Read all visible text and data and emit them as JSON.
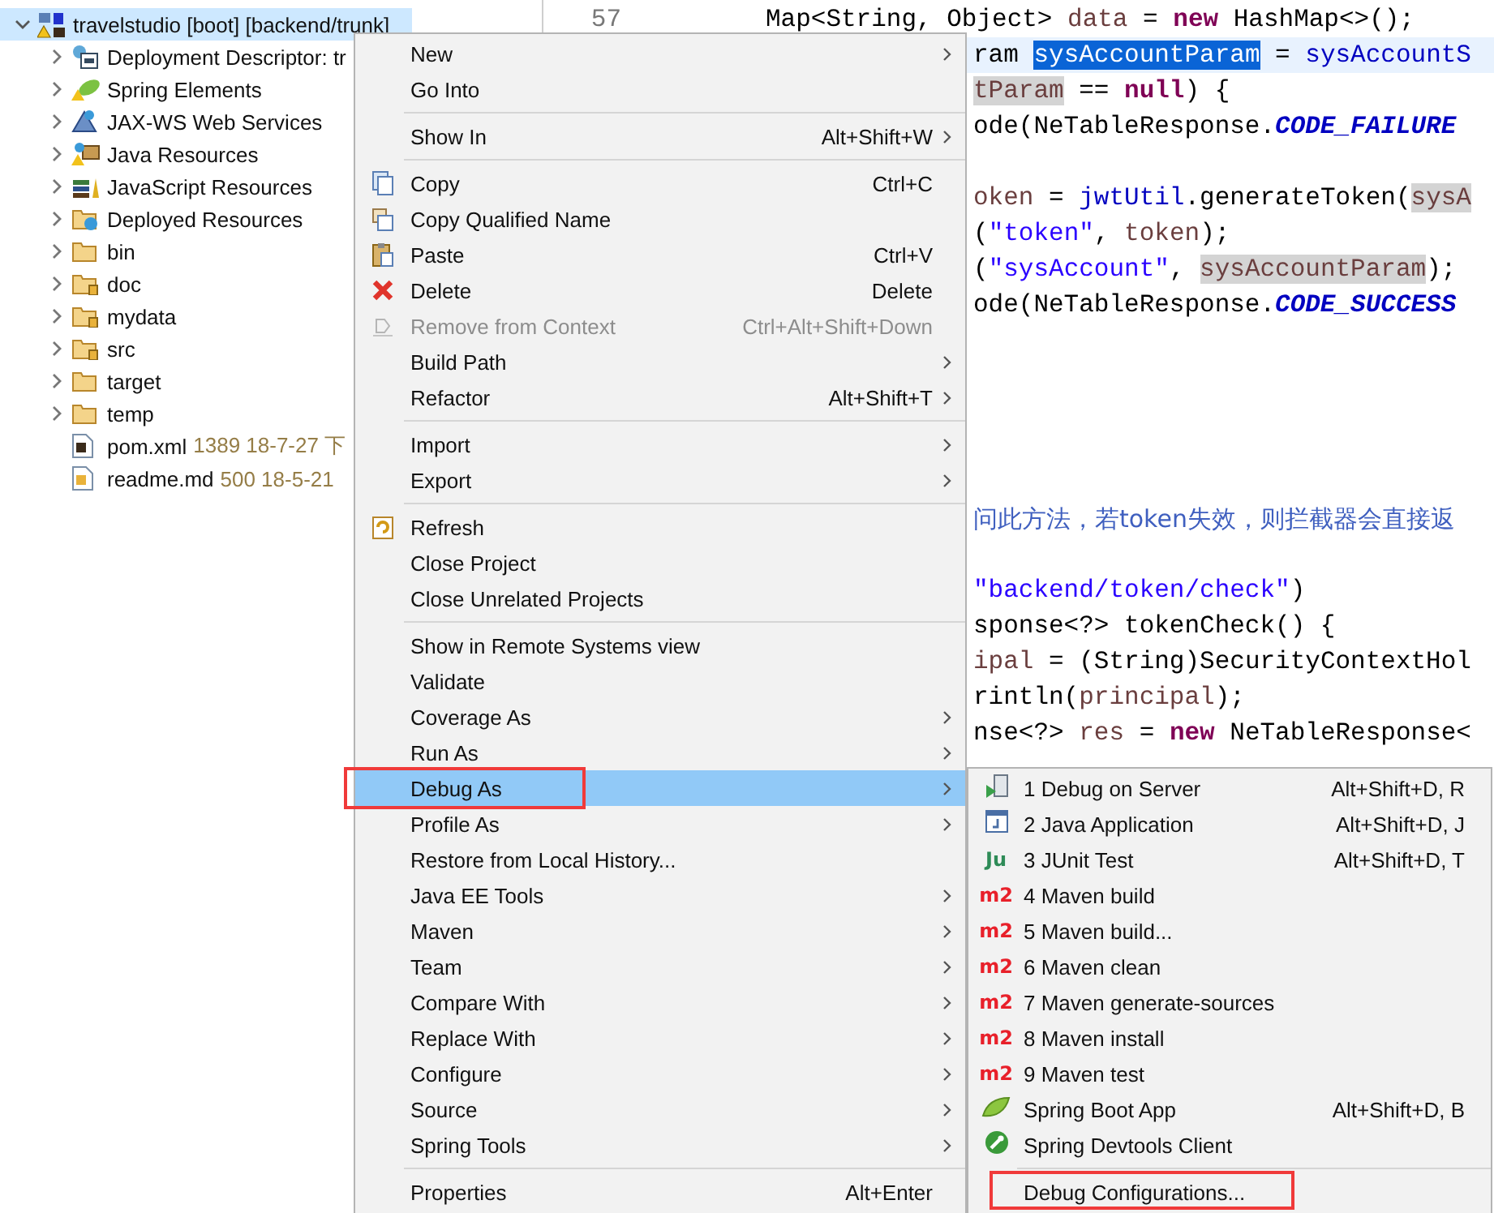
{
  "project_tree": {
    "items": [
      {
        "label": "travelstudio [boot] [backend/trunk]",
        "expanded": true,
        "selected": true,
        "children": [
          {
            "label": "Deployment Descriptor: tr",
            "expanded": false,
            "selected": false
          },
          {
            "label": "Spring Elements",
            "expanded": false,
            "selected": false
          },
          {
            "label": "JAX-WS Web Services",
            "expanded": false,
            "selected": false
          },
          {
            "label": "Java Resources",
            "expanded": false,
            "selected": false
          },
          {
            "label": "JavaScript Resources",
            "expanded": false,
            "selected": false
          },
          {
            "label": "Deployed Resources",
            "expanded": false,
            "selected": false
          },
          {
            "label": "bin",
            "expanded": false,
            "selected": false
          },
          {
            "label": "doc",
            "expanded": false,
            "selected": false
          },
          {
            "label": "mydata",
            "expanded": false,
            "selected": false
          },
          {
            "label": "src",
            "expanded": false,
            "selected": false
          },
          {
            "label": "target",
            "expanded": false,
            "selected": false
          },
          {
            "label": "temp",
            "expanded": false,
            "selected": false
          },
          {
            "label": "pom.xml",
            "decoration": "1389  18-7-27 下",
            "selected": false
          },
          {
            "label": "readme.md",
            "decoration": "500  18-5-21",
            "selected": false
          }
        ]
      }
    ]
  },
  "editor": {
    "lines": [
      {
        "kind": "full",
        "number": "57",
        "current": false,
        "segments": [
          {
            "text": "Map<String, Object> ",
            "kind": "plain"
          },
          {
            "text": "data",
            "kind": "local"
          },
          {
            "text": " = ",
            "kind": "plain"
          },
          {
            "text": "new",
            "kind": "keyword"
          },
          {
            "text": " HashMap<>();",
            "kind": "plain"
          }
        ]
      },
      {
        "kind": "clipped",
        "current": true,
        "segments": [
          {
            "text": "ram ",
            "kind": "plain"
          },
          {
            "text": "sysAccountParam",
            "kind": "selection"
          },
          {
            "text": " = ",
            "kind": "plain"
          },
          {
            "text": "sysAccountS",
            "kind": "field"
          }
        ]
      },
      {
        "kind": "clipped",
        "current": false,
        "segments": [
          {
            "text": "tParam",
            "kind": "occurrence"
          },
          {
            "text": " == ",
            "kind": "plain"
          },
          {
            "text": "null",
            "kind": "keyword"
          },
          {
            "text": ") {",
            "kind": "plain"
          }
        ]
      },
      {
        "kind": "clipped",
        "current": false,
        "segments": [
          {
            "text": "ode(NeTableResponse.",
            "kind": "plain"
          },
          {
            "text": "CODE_FAILURE",
            "kind": "constant"
          }
        ]
      },
      {
        "kind": "blank"
      },
      {
        "kind": "clipped",
        "current": false,
        "segments": [
          {
            "text": "oken",
            "kind": "local"
          },
          {
            "text": " = ",
            "kind": "plain"
          },
          {
            "text": "jwtUtil",
            "kind": "field"
          },
          {
            "text": ".generateToken(",
            "kind": "plain"
          },
          {
            "text": "sysA",
            "kind": "occurrence"
          }
        ]
      },
      {
        "kind": "clipped",
        "current": false,
        "segments": [
          {
            "text": "(",
            "kind": "plain"
          },
          {
            "text": "\"token\"",
            "kind": "string"
          },
          {
            "text": ", ",
            "kind": "plain"
          },
          {
            "text": "token",
            "kind": "local"
          },
          {
            "text": ");",
            "kind": "plain"
          }
        ]
      },
      {
        "kind": "clipped",
        "current": false,
        "segments": [
          {
            "text": "(",
            "kind": "plain"
          },
          {
            "text": "\"sysAccount\"",
            "kind": "string"
          },
          {
            "text": ", ",
            "kind": "plain"
          },
          {
            "text": "sysAccountParam",
            "kind": "occurrence"
          },
          {
            "text": ");",
            "kind": "plain"
          }
        ]
      },
      {
        "kind": "clipped",
        "current": false,
        "segments": [
          {
            "text": "ode(NeTableResponse.",
            "kind": "plain"
          },
          {
            "text": "CODE_SUCCESS",
            "kind": "constant"
          }
        ]
      },
      {
        "kind": "blank"
      },
      {
        "kind": "blank"
      },
      {
        "kind": "blank"
      },
      {
        "kind": "blank"
      },
      {
        "kind": "blank"
      },
      {
        "kind": "clipped",
        "current": false,
        "segments": [
          {
            "text": "问此方法，若token失效，则拦截器会直接返",
            "kind": "comment"
          }
        ]
      },
      {
        "kind": "blank"
      },
      {
        "kind": "clipped",
        "current": false,
        "segments": [
          {
            "text": "\"backend/token/check\"",
            "kind": "string"
          },
          {
            "text": ")",
            "kind": "plain"
          }
        ]
      },
      {
        "kind": "clipped",
        "current": false,
        "segments": [
          {
            "text": "sponse<?> tokenCheck() {",
            "kind": "plain"
          }
        ]
      },
      {
        "kind": "clipped",
        "current": false,
        "segments": [
          {
            "text": "ipal",
            "kind": "local"
          },
          {
            "text": " = (String)SecurityContextHol",
            "kind": "plain"
          }
        ]
      },
      {
        "kind": "clipped",
        "current": false,
        "segments": [
          {
            "text": "rintln(",
            "kind": "plain"
          },
          {
            "text": "principal",
            "kind": "local"
          },
          {
            "text": ");",
            "kind": "plain"
          }
        ]
      },
      {
        "kind": "clipped",
        "current": false,
        "segments": [
          {
            "text": "nse<?> ",
            "kind": "plain"
          },
          {
            "text": "res",
            "kind": "local"
          },
          {
            "text": " = ",
            "kind": "plain"
          },
          {
            "text": "new",
            "kind": "keyword"
          },
          {
            "text": " NeTableResponse<",
            "kind": "plain"
          }
        ]
      }
    ]
  },
  "context_menu": {
    "items": [
      {
        "kind": "item",
        "label": "New",
        "submenu": true,
        "disabled": false,
        "selected": false,
        "marked": false
      },
      {
        "kind": "item",
        "label": "Go Into",
        "submenu": false,
        "disabled": false,
        "selected": false,
        "marked": false
      },
      {
        "kind": "separator"
      },
      {
        "kind": "item",
        "label": "Show In",
        "shortcut": "Alt+Shift+W",
        "submenu": true,
        "disabled": false,
        "selected": false,
        "marked": false
      },
      {
        "kind": "separator"
      },
      {
        "kind": "item",
        "label": "Copy",
        "shortcut": "Ctrl+C",
        "submenu": false,
        "disabled": false,
        "selected": false,
        "marked": false
      },
      {
        "kind": "item",
        "label": "Copy Qualified Name",
        "submenu": false,
        "disabled": false,
        "selected": false,
        "marked": false
      },
      {
        "kind": "item",
        "label": "Paste",
        "shortcut": "Ctrl+V",
        "submenu": false,
        "disabled": false,
        "selected": false,
        "marked": false
      },
      {
        "kind": "item",
        "label": "Delete",
        "shortcut": "Delete",
        "submenu": false,
        "disabled": false,
        "selected": false,
        "marked": false
      },
      {
        "kind": "item",
        "label": "Remove from Context",
        "shortcut": "Ctrl+Alt+Shift+Down",
        "submenu": false,
        "disabled": true,
        "selected": false,
        "marked": false
      },
      {
        "kind": "item",
        "label": "Build Path",
        "submenu": true,
        "disabled": false,
        "selected": false,
        "marked": false
      },
      {
        "kind": "item",
        "label": "Refactor",
        "shortcut": "Alt+Shift+T",
        "submenu": true,
        "disabled": false,
        "selected": false,
        "marked": false
      },
      {
        "kind": "separator"
      },
      {
        "kind": "item",
        "label": "Import",
        "submenu": true,
        "disabled": false,
        "selected": false,
        "marked": false
      },
      {
        "kind": "item",
        "label": "Export",
        "submenu": true,
        "disabled": false,
        "selected": false,
        "marked": false
      },
      {
        "kind": "separator"
      },
      {
        "kind": "item",
        "label": "Refresh",
        "submenu": false,
        "disabled": false,
        "selected": false,
        "marked": false
      },
      {
        "kind": "item",
        "label": "Close Project",
        "submenu": false,
        "disabled": false,
        "selected": false,
        "marked": false
      },
      {
        "kind": "item",
        "label": "Close Unrelated Projects",
        "submenu": false,
        "disabled": false,
        "selected": false,
        "marked": false
      },
      {
        "kind": "separator"
      },
      {
        "kind": "item",
        "label": "Show in Remote Systems view",
        "submenu": false,
        "disabled": false,
        "selected": false,
        "marked": false
      },
      {
        "kind": "item",
        "label": "Validate",
        "submenu": false,
        "disabled": false,
        "selected": false,
        "marked": false
      },
      {
        "kind": "item",
        "label": "Coverage As",
        "submenu": true,
        "disabled": false,
        "selected": false,
        "marked": false
      },
      {
        "kind": "item",
        "label": "Run As",
        "submenu": true,
        "disabled": false,
        "selected": false,
        "marked": false
      },
      {
        "kind": "item",
        "label": "Debug As",
        "submenu": true,
        "disabled": false,
        "selected": true,
        "marked": true
      },
      {
        "kind": "item",
        "label": "Profile As",
        "submenu": true,
        "disabled": false,
        "selected": false,
        "marked": false
      },
      {
        "kind": "item",
        "label": "Restore from Local History...",
        "submenu": false,
        "disabled": false,
        "selected": false,
        "marked": false
      },
      {
        "kind": "item",
        "label": "Java EE Tools",
        "submenu": true,
        "disabled": false,
        "selected": false,
        "marked": false
      },
      {
        "kind": "item",
        "label": "Maven",
        "submenu": true,
        "disabled": false,
        "selected": false,
        "marked": false
      },
      {
        "kind": "item",
        "label": "Team",
        "submenu": true,
        "disabled": false,
        "selected": false,
        "marked": false
      },
      {
        "kind": "item",
        "label": "Compare With",
        "submenu": true,
        "disabled": false,
        "selected": false,
        "marked": false
      },
      {
        "kind": "item",
        "label": "Replace With",
        "submenu": true,
        "disabled": false,
        "selected": false,
        "marked": false
      },
      {
        "kind": "item",
        "label": "Configure",
        "submenu": true,
        "disabled": false,
        "selected": false,
        "marked": false
      },
      {
        "kind": "item",
        "label": "Source",
        "submenu": true,
        "disabled": false,
        "selected": false,
        "marked": false
      },
      {
        "kind": "item",
        "label": "Spring Tools",
        "submenu": true,
        "disabled": false,
        "selected": false,
        "marked": false
      },
      {
        "kind": "separator"
      },
      {
        "kind": "item",
        "label": "Properties",
        "shortcut": "Alt+Enter",
        "submenu": false,
        "disabled": false,
        "selected": false,
        "marked": false
      }
    ]
  },
  "submenu": {
    "items": [
      {
        "kind": "item",
        "label": "1 Debug on Server",
        "shortcut": "Alt+Shift+D, R",
        "marked": false
      },
      {
        "kind": "item",
        "label": "2 Java Application",
        "shortcut": "Alt+Shift+D, J",
        "marked": false
      },
      {
        "kind": "item",
        "label": "3 JUnit Test",
        "shortcut": "Alt+Shift+D, T",
        "icon_text": "Ju",
        "color": "#2e8b57",
        "marked": false
      },
      {
        "kind": "item",
        "label": "4 Maven build",
        "icon_text": "m2",
        "color": "#e8202a",
        "marked": false
      },
      {
        "kind": "item",
        "label": "5 Maven build...",
        "icon_text": "m2",
        "color": "#e8202a",
        "marked": false
      },
      {
        "kind": "item",
        "label": "6 Maven clean",
        "icon_text": "m2",
        "color": "#e8202a",
        "marked": false
      },
      {
        "kind": "item",
        "label": "7 Maven generate-sources",
        "icon_text": "m2",
        "color": "#e8202a",
        "marked": false
      },
      {
        "kind": "item",
        "label": "8 Maven install",
        "icon_text": "m2",
        "color": "#e8202a",
        "marked": false
      },
      {
        "kind": "item",
        "label": "9 Maven test",
        "icon_text": "m2",
        "color": "#e8202a",
        "marked": false
      },
      {
        "kind": "item",
        "label": "Spring Boot App",
        "shortcut": "Alt+Shift+D, B",
        "marked": false
      },
      {
        "kind": "item",
        "label": "Spring Devtools Client",
        "marked": false
      },
      {
        "kind": "separator"
      },
      {
        "kind": "item",
        "label": "Debug Configurations...",
        "marked": true
      }
    ]
  }
}
